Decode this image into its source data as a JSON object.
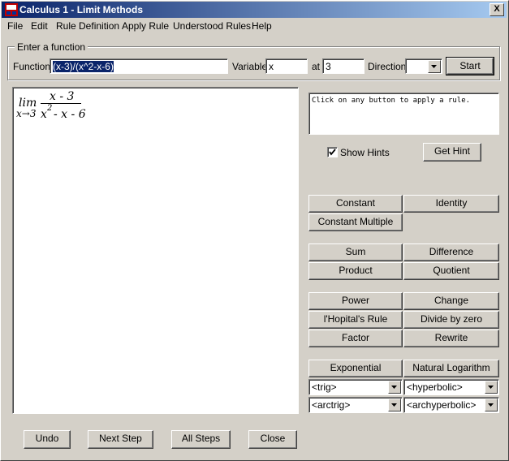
{
  "window": {
    "title": "Calculus 1 - Limit Methods",
    "close_glyph": "X"
  },
  "menu": [
    "File",
    "Edit",
    "Rule Definition",
    "Apply Rule",
    "Understood Rules",
    "Help"
  ],
  "input_group": {
    "label": "Enter a function",
    "function_label": "Function",
    "function_value": "(x-3)/(x^2-x-6)",
    "variable_label": "Variable",
    "variable_value": "x",
    "at_label": "at",
    "at_value": "3",
    "direction_label": "Direction",
    "direction_value": "",
    "start_label": "Start"
  },
  "expression": {
    "lim": "lim",
    "sub": "x→3",
    "numerator": "x - 3",
    "den_base": "x",
    "den_exp": "2",
    "den_rest": "- x - 6"
  },
  "message": "Click on any button to apply a rule.",
  "hints": {
    "label": "Show Hints",
    "checked": true,
    "get_hint_label": "Get Hint"
  },
  "rules": {
    "constant": "Constant",
    "identity": "Identity",
    "constant_multiple": "Constant Multiple",
    "sum": "Sum",
    "difference": "Difference",
    "product": "Product",
    "quotient": "Quotient",
    "power": "Power",
    "change": "Change",
    "lhopital": "l'Hopital's Rule",
    "divide_by_zero": "Divide by zero",
    "factor": "Factor",
    "rewrite": "Rewrite",
    "exponential": "Exponential",
    "natural_log": "Natural Logarithm"
  },
  "dropdowns": {
    "trig": "<trig>",
    "hyperbolic": "<hyperbolic>",
    "arctrig": "<arctrig>",
    "archyperbolic": "<archyperbolic>"
  },
  "bottom": {
    "undo": "Undo",
    "next_step": "Next Step",
    "all_steps": "All Steps",
    "close": "Close"
  },
  "colors": {
    "title_start": "#0a246a",
    "title_end": "#a6caf0",
    "face": "#d4d0c8"
  }
}
